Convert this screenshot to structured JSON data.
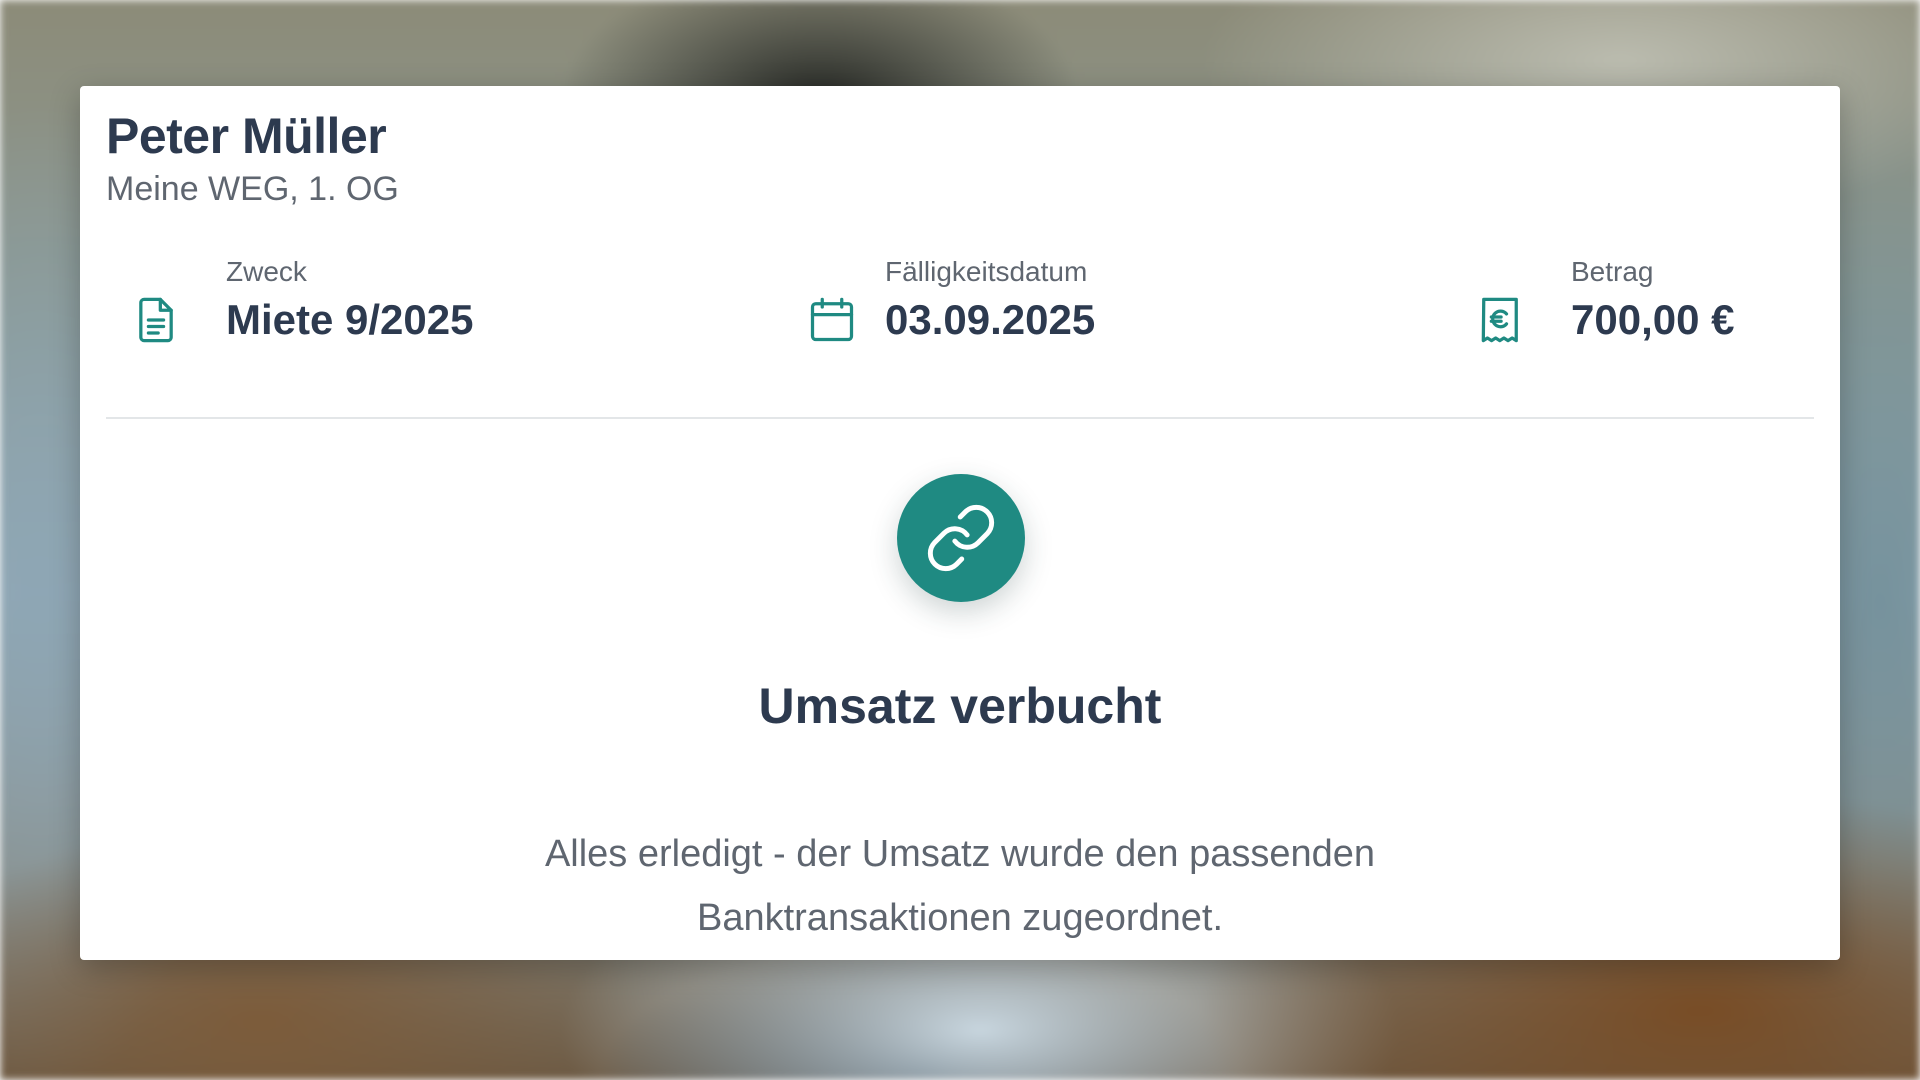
{
  "tenant": {
    "name": "Peter Müller",
    "unit": "Meine WEG, 1. OG"
  },
  "details": {
    "purpose_label": "Zweck",
    "purpose_value": "Miete 9/2025",
    "due_date_label": "Fälligkeitsdatum",
    "due_date_value": "03.09.2025",
    "amount_label": "Betrag",
    "amount_value": "700,00 €"
  },
  "success": {
    "title": "Umsatz verbucht",
    "message": "Alles erledigt - der Umsatz wurde den passenden Banktransaktionen zugeordnet."
  },
  "icons": {
    "purpose": "document-icon",
    "due_date": "calendar-icon",
    "amount": "euro-receipt-icon",
    "success": "link-icon"
  },
  "colors": {
    "accent": "#1f8a82",
    "heading": "#2d3a4f",
    "muted": "#5f6670"
  }
}
